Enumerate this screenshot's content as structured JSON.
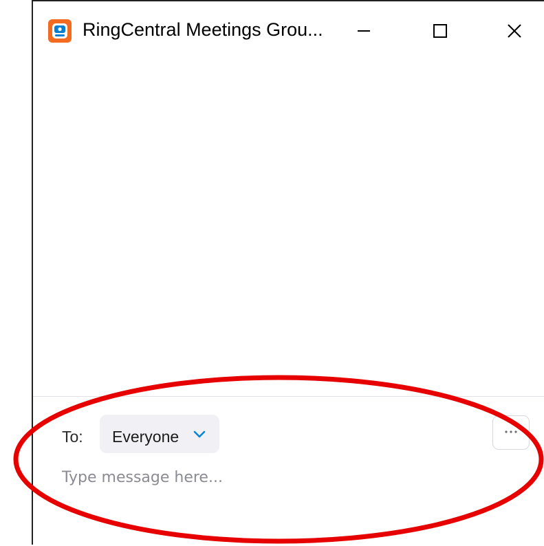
{
  "window": {
    "title": "RingCentral Meetings Grou...",
    "app_icon": "ringcentral-app-icon",
    "controls": {
      "minimize_icon": "minimize-icon",
      "maximize_icon": "maximize-icon",
      "close_icon": "close-icon"
    }
  },
  "compose": {
    "to_label": "To:",
    "recipient": "Everyone",
    "recipient_icon": "chevron-down-icon",
    "more_icon": "more-options-icon",
    "message_placeholder": "Type message here...",
    "message_value": ""
  },
  "colors": {
    "accent": "#0a84d6",
    "brand_orange": "#f36b21",
    "highlight_red": "#e60000"
  }
}
